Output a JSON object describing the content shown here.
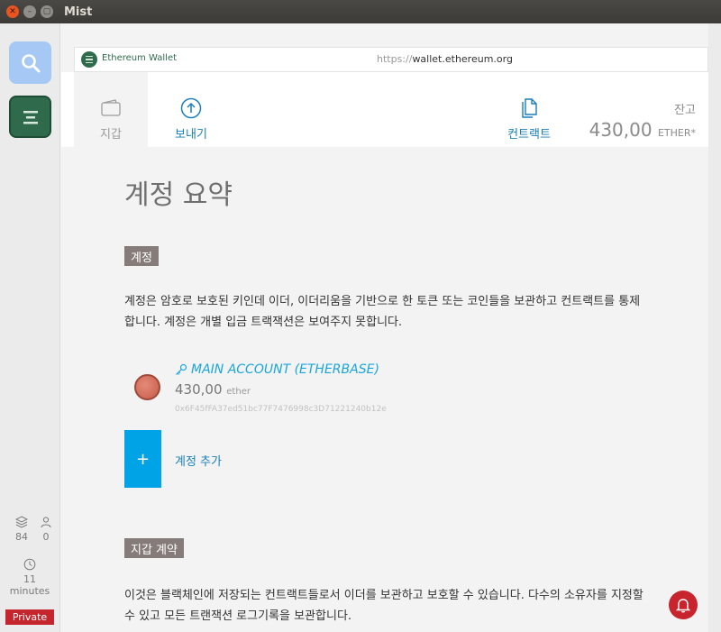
{
  "window": {
    "title": "Mist"
  },
  "sidebar": {
    "peers": "84",
    "peer_users": "0",
    "block_time_value": "11",
    "block_time_unit": "minutes",
    "network_badge": "Private"
  },
  "urlbar": {
    "app_name": "Ethereum Wallet",
    "url_protocol": "https://",
    "url_host": "wallet.ethereum.org"
  },
  "nav": {
    "wallets": "지갑",
    "send": "보내기",
    "contracts": "컨트랙트"
  },
  "balance": {
    "label": "잔고",
    "value": "430,00",
    "unit": "ETHER*"
  },
  "main": {
    "title": "계정 요약",
    "accounts_section": "계정",
    "accounts_desc": "계정은 암호로 보호된 키인데 이더, 이더리움을 기반으로 한 토큰 또는 코인들을 보관하고 컨트랙트를 통제합니다. 계정은 개별 입금 트랙잭션은 보여주지 못합니다.",
    "account": {
      "name": "MAIN ACCOUNT (ETHERBASE)",
      "balance": "430,00",
      "unit": "ether",
      "address": "0x6F45fFA37ed51bc77F7476998c3D71221240b12e"
    },
    "add_account": "계정 추가",
    "wallet_contracts_section": "지갑 계약",
    "wallet_contracts_desc": "이것은 블랙체인에 저장되는 컨트랙트들로서 이더를 보관하고 보호할 수 있습니다. 다수의 소유자를 지정할 수 있고 모든 트랜잭션 로그기록을 보관합니다."
  },
  "colors": {
    "accent": "#1b7fba",
    "account_link": "#1aa6dc",
    "add_button": "#00a3e6",
    "private_badge": "#c5262e",
    "section_tag": "#857c79"
  }
}
